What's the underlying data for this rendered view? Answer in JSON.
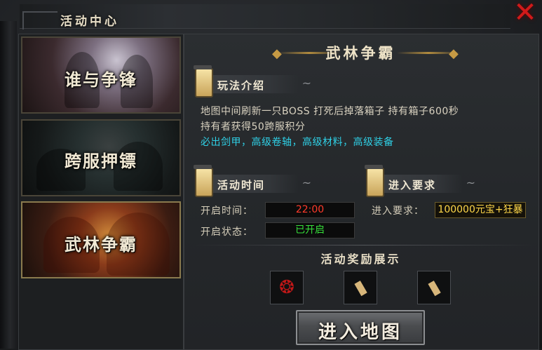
{
  "window": {
    "title": "活动中心"
  },
  "events": [
    {
      "label": "谁与争锋"
    },
    {
      "label": "跨服押镖"
    },
    {
      "label": "武林争霸"
    }
  ],
  "detail": {
    "title": "武林争霸",
    "rules": {
      "header": "玩法介绍",
      "lines": [
        "地图中间刷新一只BOSS   打死后掉落箱子   持有箱子600秒",
        "持有者获得50跨服积分",
        "必出剑甲，高级卷轴，高级材料，高级装备"
      ]
    },
    "time": {
      "header": "活动时间",
      "open_time_label": "开启时间：",
      "open_time_value": "22:00",
      "status_label": "开启状态：",
      "status_value": "已开启"
    },
    "requirement": {
      "header": "进入要求",
      "label": "进入要求：",
      "value": "100000元宝+狂暴"
    },
    "rewards": {
      "title": "活动奖励展示",
      "items": [
        "red-orb-icon",
        "scroll-icon",
        "scroll-icon"
      ]
    },
    "enter_button": "进入地图"
  },
  "colors": {
    "accent_gold": "#c69a44",
    "cyan_text": "#2fd0e6",
    "time_red": "#ff3a2a",
    "status_green": "#36e03a",
    "requirement_gold": "#ffd84a",
    "close_red": "#d11a1a"
  }
}
